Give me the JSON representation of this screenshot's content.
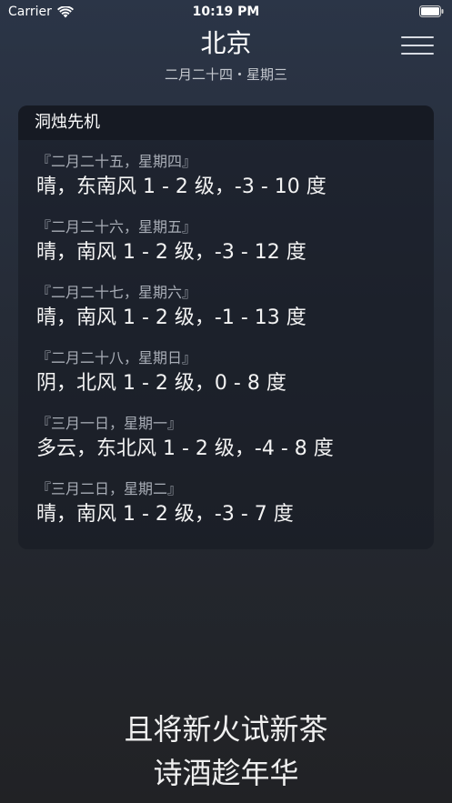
{
  "status_bar": {
    "carrier": "Carrier",
    "time": "10:19 PM"
  },
  "header": {
    "city": "北京",
    "date": "二月二十四・星期三"
  },
  "forecast": {
    "title": "洞烛先机",
    "items": [
      {
        "date": "『二月二十五，星期四』",
        "desc": "晴，东南风 1 - 2 级，-3 - 10 度"
      },
      {
        "date": "『二月二十六，星期五』",
        "desc": "晴，南风 1 - 2 级，-3 - 12 度"
      },
      {
        "date": "『二月二十七，星期六』",
        "desc": "晴，南风 1 - 2 级，-1 - 13 度"
      },
      {
        "date": "『二月二十八，星期日』",
        "desc": "阴，北风 1 - 2 级，0 - 8 度"
      },
      {
        "date": "『三月一日，星期一』",
        "desc": "多云，东北风 1 - 2 级，-4 - 8 度"
      },
      {
        "date": "『三月二日，星期二』",
        "desc": "晴，南风 1 - 2 级，-3 - 7 度"
      }
    ]
  },
  "poem": {
    "line1": "且将新火试新茶",
    "line2": "诗酒趁年华"
  },
  "icons": {
    "wifi": "wifi-icon",
    "battery": "battery-icon",
    "menu": "hamburger-menu-icon"
  }
}
